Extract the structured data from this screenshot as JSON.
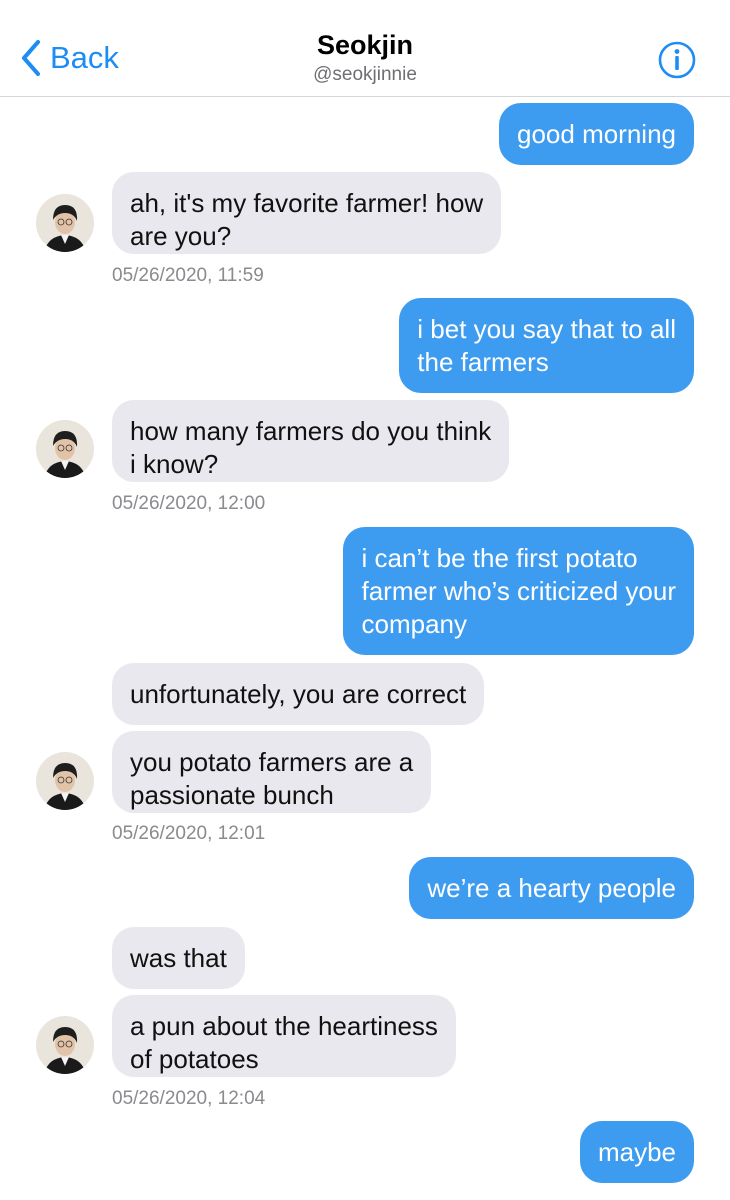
{
  "header": {
    "back_label": "Back",
    "contact_name": "Seokjin",
    "contact_handle": "@seokjinnie"
  },
  "icons": {
    "back": "chevron-left-icon",
    "info": "info-circle-icon",
    "avatar": "avatar"
  },
  "colors": {
    "accent": "#1d8cf5",
    "outgoing_bubble": "#3e9cf0",
    "incoming_bubble": "#e8e8ee",
    "timestamp": "#8a8a8f"
  },
  "messages": [
    {
      "dir": "out",
      "lines": [
        "good morning"
      ]
    },
    {
      "dir": "in",
      "lines": [
        "ah, it's my favorite farmer! how",
        "are you?"
      ]
    },
    {
      "dir": "out",
      "lines": [
        "i bet you say that to all",
        "the farmers"
      ]
    },
    {
      "dir": "in",
      "lines": [
        "how many farmers do you think",
        "i know?"
      ]
    },
    {
      "dir": "out",
      "lines": [
        "i can’t be the first potato",
        "farmer who’s criticized your",
        "company"
      ]
    },
    {
      "dir": "in",
      "lines": [
        "unfortunately, you are correct"
      ]
    },
    {
      "dir": "in",
      "lines": [
        "you potato farmers are a",
        "passionate bunch"
      ]
    },
    {
      "dir": "out",
      "lines": [
        "we’re a hearty people"
      ]
    },
    {
      "dir": "in",
      "lines": [
        "was that"
      ]
    },
    {
      "dir": "in",
      "lines": [
        "a pun about the heartiness",
        "of potatoes"
      ]
    },
    {
      "dir": "out",
      "lines": [
        "maybe"
      ]
    }
  ],
  "timestamps": [
    "05/26/2020, 11:59",
    "05/26/2020, 12:00",
    "05/26/2020, 12:01",
    "05/26/2020, 12:04"
  ]
}
